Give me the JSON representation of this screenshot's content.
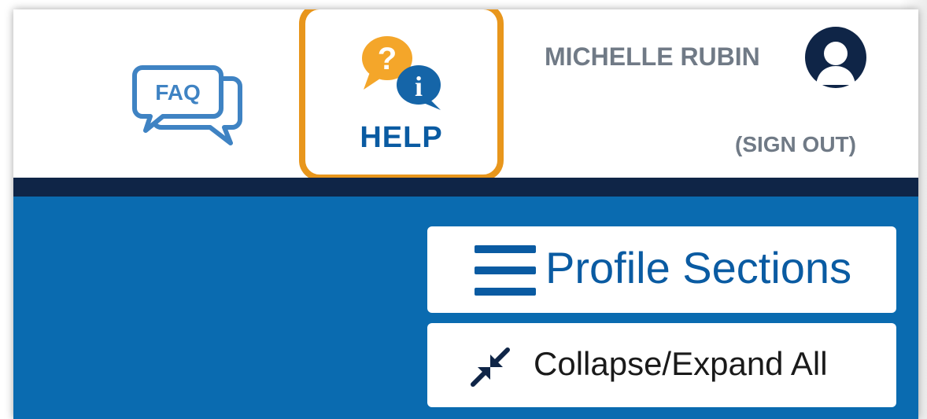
{
  "header": {
    "faq": {
      "icon": "faq-speech-bubbles-icon",
      "icon_text": "FAQ"
    },
    "help": {
      "icon": "help-chat-bubbles-icon",
      "label": "HELP",
      "highlight_color": "#e8961c"
    },
    "user": {
      "name": "MICHELLE RUBIN",
      "avatar_icon": "user-avatar-icon",
      "sign_out_label": "(SIGN OUT)"
    }
  },
  "toolbar": {
    "profile_sections": {
      "icon": "menu-icon",
      "label": "Profile Sections"
    },
    "collapse_expand": {
      "icon": "collapse-arrows-icon",
      "label": "Collapse/Expand All"
    }
  },
  "colors": {
    "brand_blue": "#0a6bb0",
    "navy_bar": "#0f2547",
    "help_orange": "#e8961c",
    "label_blue": "#0a5ba2",
    "gray_text": "#707a86"
  }
}
